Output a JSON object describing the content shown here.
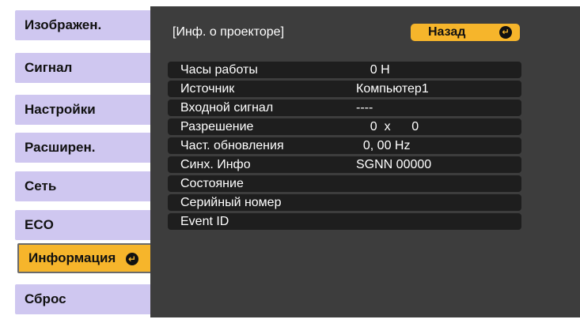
{
  "menu": {
    "items": [
      {
        "label": "Изображен."
      },
      {
        "label": "Сигнал"
      },
      {
        "label": "Настройки"
      },
      {
        "label": "Расширен."
      },
      {
        "label": "Сеть"
      },
      {
        "label": "ECO"
      },
      {
        "label": "Информация",
        "active": true
      },
      {
        "label": "Сброс"
      }
    ]
  },
  "panel": {
    "title": "[Инф. о проекторе]",
    "back_label": "Назад",
    "rows": [
      {
        "label": "Часы работы",
        "value": "    0 H"
      },
      {
        "label": "Источник",
        "value": "Компьютер1"
      },
      {
        "label": "Входной сигнал",
        "value": "----"
      },
      {
        "label": "Разрешение",
        "value": "    0  x      0"
      },
      {
        "label": "Част. обновления",
        "value": "  0, 00 Hz"
      },
      {
        "label": "Синх. Инфо",
        "value": "SGNN 00000"
      },
      {
        "label": "Состояние",
        "value": ""
      },
      {
        "label": "Серийный номер",
        "value": ""
      },
      {
        "label": "Event ID",
        "value": ""
      }
    ]
  },
  "colors": {
    "menu_item": "#cfc7f0",
    "menu_active": "#f6b52b",
    "panel_bg": "#3d3d3d",
    "row_bg": "#1e1e1e",
    "accent": "#f6b52b"
  },
  "icons": {
    "enter": "enter-icon"
  }
}
